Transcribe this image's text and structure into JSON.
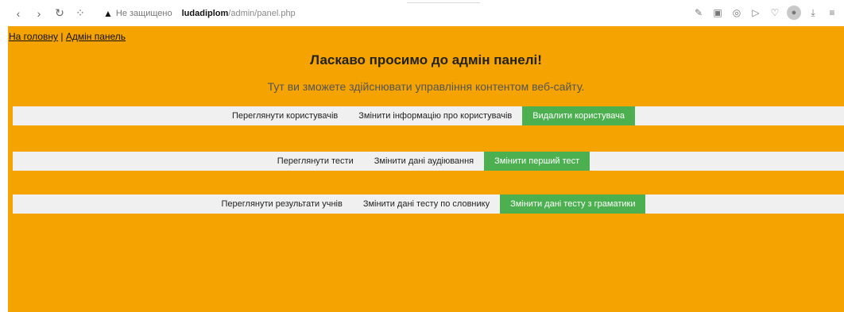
{
  "browser": {
    "security_label": "Не защищено",
    "url_host": "ludadiplom",
    "url_path": "/admin/panel.php"
  },
  "nav": {
    "home_link": "На головну",
    "separator": "|",
    "admin_link": "Адмін панель"
  },
  "main": {
    "heading": "Ласкаво просимо до адмін панелі!",
    "subtitle": "Тут ви зможете здійснювати управління контентом веб-сайту."
  },
  "rows": [
    {
      "items": [
        {
          "label": "Переглянути користувачів",
          "active": false
        },
        {
          "label": "Змінити інформацію про користувачів",
          "active": false
        },
        {
          "label": "Видалити користувача",
          "active": true
        }
      ]
    },
    {
      "items": [
        {
          "label": "Переглянути тести",
          "active": false
        },
        {
          "label": "Змінити дані аудіювання",
          "active": false
        },
        {
          "label": "Змінити перший тест",
          "active": true
        }
      ]
    },
    {
      "items": [
        {
          "label": "Переглянути результати учнів",
          "active": false
        },
        {
          "label": "Змінити дані тесту по словнику",
          "active": false
        },
        {
          "label": "Змінити дані тесту з граматики",
          "active": true
        }
      ]
    }
  ],
  "colors": {
    "page_bg": "#f4a300",
    "menu_bg": "#f0f0f0",
    "active_bg": "#4caf50"
  }
}
